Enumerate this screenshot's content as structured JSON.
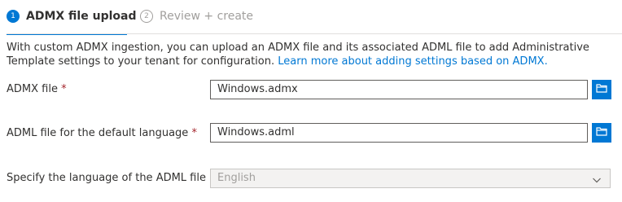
{
  "wizard": {
    "steps": [
      {
        "number": "1",
        "label": "ADMX file upload"
      },
      {
        "number": "2",
        "label": "Review + create"
      }
    ]
  },
  "description": {
    "text": "With custom ADMX ingestion, you can upload an ADMX file and its associated ADML file to add Administrative Template settings to your tenant for configuration. ",
    "link": "Learn more about adding settings based on ADMX."
  },
  "form": {
    "admx": {
      "label": "ADMX file",
      "required": "*",
      "value": "Windows.admx"
    },
    "adml": {
      "label": "ADML file for the default language",
      "required": "*",
      "value": "Windows.adml"
    },
    "language": {
      "label": "Specify the language of the ADML file",
      "value": "English"
    }
  },
  "icons": {
    "browse": "folder-open-icon",
    "info": "info-icon",
    "dropdown": "chevron-down-icon"
  },
  "colors": {
    "accent": "#0078d4",
    "required": "#a4262c",
    "muted": "#a19f9d"
  }
}
